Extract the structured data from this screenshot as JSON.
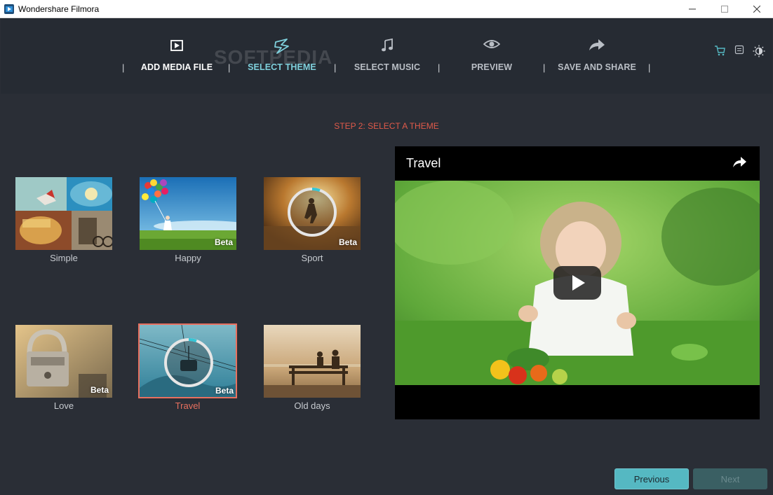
{
  "window": {
    "title": "Wondershare Filmora"
  },
  "header": {
    "watermark": "SOFTPEDIA",
    "steps": [
      {
        "label": "ADD MEDIA FILE",
        "state": "done",
        "icon": "film-frame-icon"
      },
      {
        "label": "SELECT THEME",
        "state": "active",
        "icon": "theme-ribbon-icon"
      },
      {
        "label": "SELECT MUSIC",
        "state": "inactive",
        "icon": "music-note-icon"
      },
      {
        "label": "PREVIEW",
        "state": "inactive",
        "icon": "eye-icon"
      },
      {
        "label": "SAVE AND SHARE",
        "state": "inactive",
        "icon": "share-arrow-icon"
      }
    ],
    "separator": "|",
    "top_icons": [
      "cart-icon",
      "menu-list-icon",
      "brightness-icon"
    ]
  },
  "main": {
    "step_title": "STEP 2: SELECT A THEME",
    "themes": [
      {
        "name": "Simple",
        "beta": "",
        "selected": false
      },
      {
        "name": "Happy",
        "beta": "Beta",
        "selected": false
      },
      {
        "name": "Sport",
        "beta": "Beta",
        "selected": false
      },
      {
        "name": "Love",
        "beta": "Beta",
        "selected": false
      },
      {
        "name": "Travel",
        "beta": "Beta",
        "selected": true
      },
      {
        "name": "Old days",
        "beta": "",
        "selected": false
      }
    ],
    "preview": {
      "title": "Travel"
    }
  },
  "footer": {
    "previous_label": "Previous",
    "next_label": "Next"
  },
  "colors": {
    "accent": "#55b8c2",
    "active_step": "#7fd0dc",
    "step_title": "#e05a4a",
    "selected_theme": "#e8705f",
    "background": "#2a2e36",
    "header": "#262b33"
  }
}
